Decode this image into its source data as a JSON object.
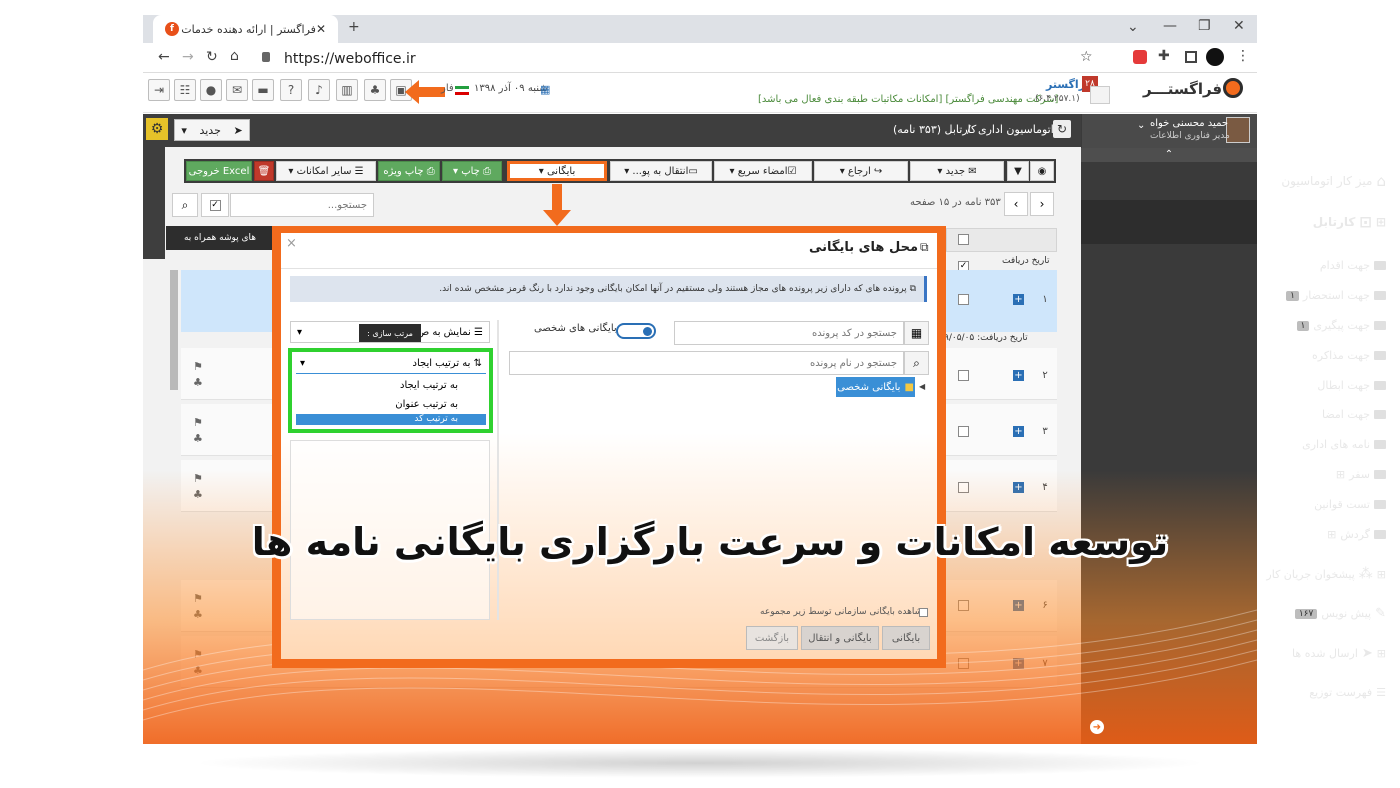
{
  "browser": {
    "tab_title": "فراگستر | ارائه دهنده خدمات اتوماسیون اد",
    "tab_close": "✕",
    "new_tab": "+",
    "url": "https://weboffice.ir"
  },
  "header": {
    "date_label": "شنبه ۰۹ آذر ۱۳۹۸",
    "date_suffix": "فار",
    "logo_text": "فراگستـــر",
    "badge_count": "۲۸",
    "company_name": "فراگستر",
    "version": "(۶.۴.۲۵۷.۱)",
    "notice": "[شرکت مهندسی فراگستر] [امکانات مکاتبات طبقه بندی فعال می باشد]"
  },
  "app_toolbar": {
    "new_label": "جدید",
    "breadcrumb_root": "اتوماسیون اداری",
    "breadcrumb_sep": "/",
    "breadcrumb_current": "کارتابل (۳۵۳ نامه)",
    "user_name": "حمید محسنی خواه",
    "user_role": "مدیر فناوری اطلاعات"
  },
  "sidebar": {
    "items": [
      {
        "label": "میز کار اتوماسیون",
        "badge": ""
      },
      {
        "label": "کارتابل",
        "badge": ""
      },
      {
        "label": "جهت اقدام",
        "badge": ""
      },
      {
        "label": "جهت استحضار",
        "badge": "۱"
      },
      {
        "label": "جهت پیگیری",
        "badge": "۱"
      },
      {
        "label": "جهت مذاکره",
        "badge": ""
      },
      {
        "label": "جهت ابطال",
        "badge": ""
      },
      {
        "label": "جهت امضا",
        "badge": ""
      },
      {
        "label": "نامه های اداری",
        "badge": ""
      },
      {
        "label": "سفر",
        "badge": ""
      },
      {
        "label": "تست قوانین",
        "badge": ""
      },
      {
        "label": "گردش",
        "badge": ""
      },
      {
        "label": "پیشخوان جریان کار",
        "badge": ""
      },
      {
        "label": "پیش نویس",
        "badge": "۱۶۷"
      },
      {
        "label": "ارسال شده ها",
        "badge": ""
      },
      {
        "label": "فهرست توزیع",
        "badge": ""
      }
    ]
  },
  "grid_toolbar": {
    "new": "جدید",
    "refer": "ارجاع",
    "quick_sign": "امضاء سریع",
    "move_to": "انتقال به پو...",
    "archive": "بایگانی",
    "print": "چاپ",
    "special_print": "چاپ ویژه",
    "other": "سایر امکانات",
    "excel": "خروجی Excel"
  },
  "grid": {
    "search_placeholder": "جستجو...",
    "paging": "۳۵۳ نامه در ۱۵ صفحه",
    "attach_header": "های پوشه همراه به",
    "date_header": "تاریخ دریافت",
    "date_row_label": "تاریخ دریافت: ۹/۰۵/۰۵",
    "rows": [
      "۱",
      "۲",
      "۳",
      "۴",
      "۶",
      "۷"
    ]
  },
  "modal": {
    "title": "محل های بایگانی",
    "close": "×",
    "info": "پرونده های که دارای زیر پرونده های مجاز هستند ولی مستقیم در آنها امکان بایگانی وجود ندارد با رنگ قرمز مشخص شده اند.",
    "search_code_placeholder": "جستجو در کد پرونده",
    "personal_archives": "بایگانی های شخصی",
    "search_name_placeholder": "جستجو در نام پرونده",
    "tree_node": "بایگانی شخصی",
    "display_label": "نمایش به ص",
    "tooltip": "مرتب سازی :",
    "sort_selected": "به ترتیب ایجاد",
    "sort_options": [
      "به ترتیب ایجاد",
      "به ترتیب عنوان",
      "به ترتیب کد"
    ],
    "org_checkbox": "مشاهده بایگانی سازمانی توسط زیر مجموعه",
    "btn_archive": "بایگانی",
    "btn_archive_move": "بایگانی و انتقال",
    "btn_back": "بازگشت"
  },
  "headline": "توسعه امکانات و سرعت بارگزاری بایگانی نامه ها",
  "colors": {
    "accent_orange": "#f26b1d",
    "highlight_green": "#2fd12f",
    "sidebar_dark": "#3a3a3a",
    "primary_blue": "#2a6fb5"
  }
}
